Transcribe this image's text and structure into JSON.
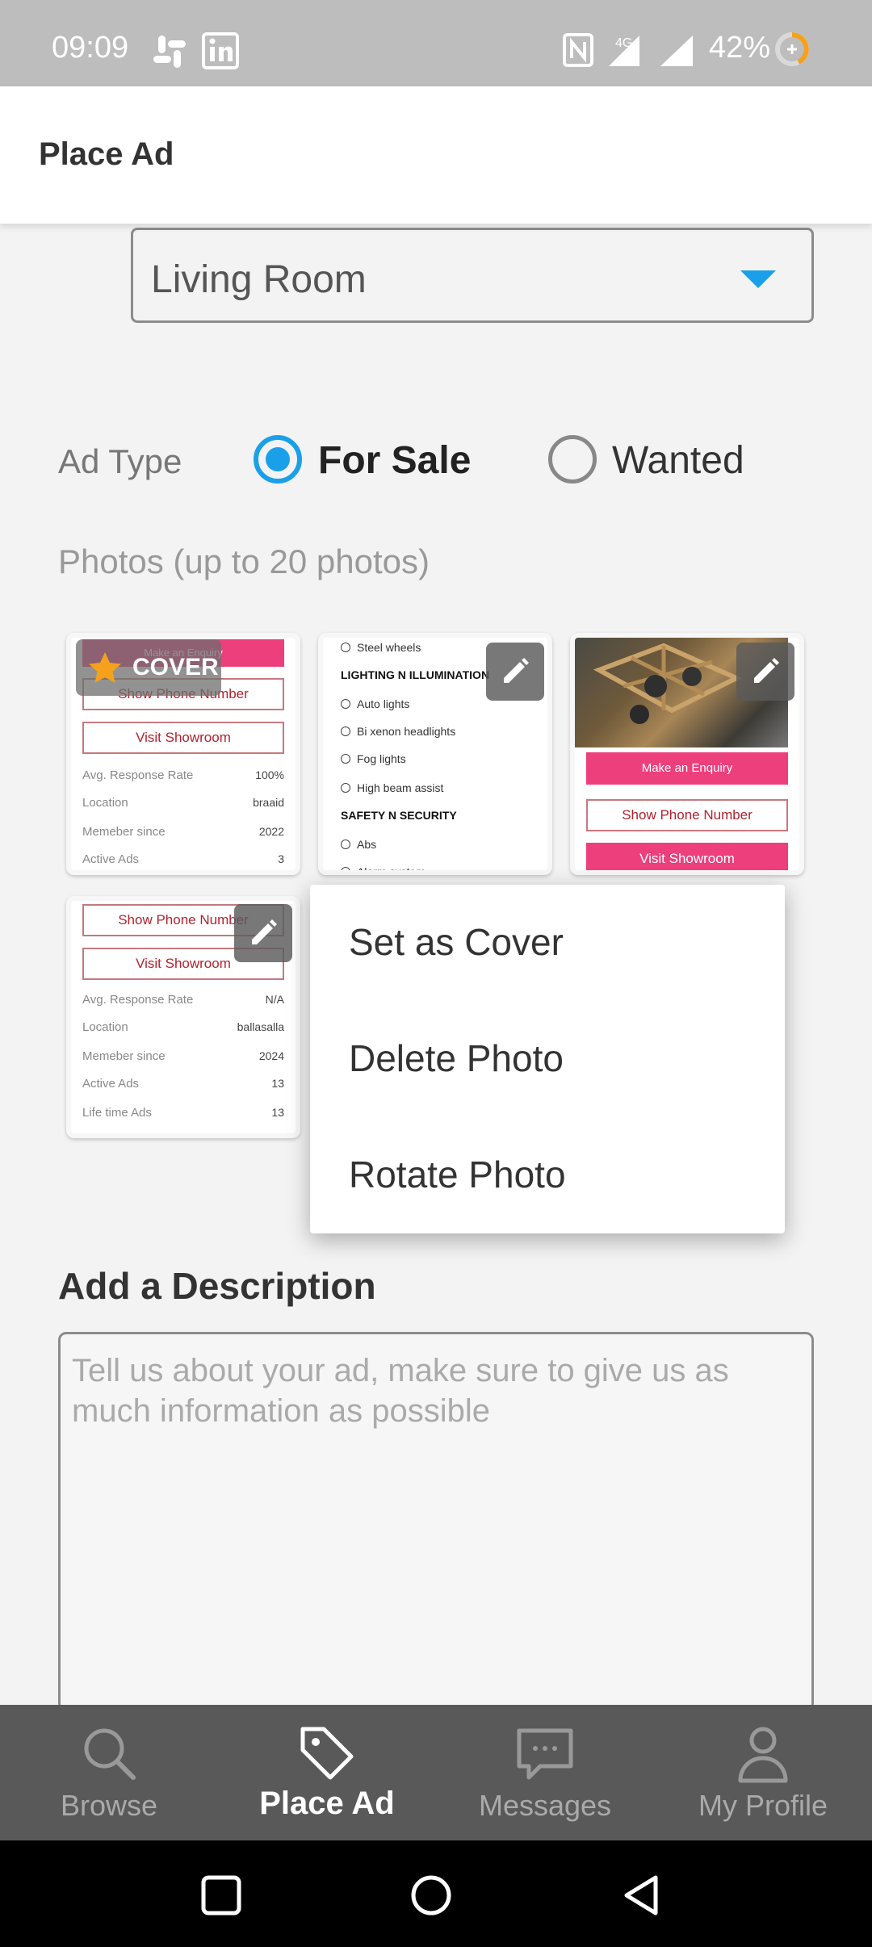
{
  "status_bar": {
    "time": "09:09",
    "network": "4G+",
    "battery": "42%"
  },
  "appbar": {
    "title": "Place Ad"
  },
  "category": {
    "value": "Living Room"
  },
  "ad_type": {
    "label": "Ad Type",
    "options": [
      {
        "label": "For Sale",
        "selected": true
      },
      {
        "label": "Wanted",
        "selected": false
      }
    ]
  },
  "photos": {
    "label": "Photos (up to 20 photos)",
    "cover_badge": "COVER",
    "thumb1": {
      "top_btn": "Make an Enquiry",
      "phone_btn": "Show Phone Number",
      "showroom_btn": "Visit Showroom",
      "rows": [
        {
          "k": "Avg. Response Rate",
          "v": "100%"
        },
        {
          "k": "Location",
          "v": "braaid"
        },
        {
          "k": "Memeber since",
          "v": "2022"
        },
        {
          "k": "Active Ads",
          "v": "3"
        }
      ]
    },
    "thumb2": {
      "items": [
        {
          "type": "item",
          "text": "Steel wheels"
        },
        {
          "type": "heading",
          "text": "LIGHTING N ILLUMINATION"
        },
        {
          "type": "item",
          "text": "Auto lights"
        },
        {
          "type": "item",
          "text": "Bi xenon headlights"
        },
        {
          "type": "item",
          "text": "Fog lights"
        },
        {
          "type": "item",
          "text": "High beam assist"
        },
        {
          "type": "heading",
          "text": "SAFETY N SECURITY"
        },
        {
          "type": "item",
          "text": "Abs"
        },
        {
          "type": "item",
          "text": "Alarm system"
        }
      ]
    },
    "thumb3": {
      "enquiry_btn": "Make an Enquiry",
      "phone_btn": "Show Phone Number",
      "showroom_btn": "Visit Showroom"
    },
    "thumb4": {
      "phone_btn": "Show Phone Number",
      "showroom_btn": "Visit Showroom",
      "rows": [
        {
          "k": "Avg. Response Rate",
          "v": "N/A"
        },
        {
          "k": "Location",
          "v": "ballasalla"
        },
        {
          "k": "Memeber since",
          "v": "2024"
        },
        {
          "k": "Active Ads",
          "v": "13"
        },
        {
          "k": "Life time Ads",
          "v": "13"
        }
      ]
    }
  },
  "photo_menu": {
    "items": [
      "Set as Cover",
      "Delete Photo",
      "Rotate Photo"
    ]
  },
  "description": {
    "title": "Add a Description",
    "placeholder": "Tell us about your ad, make sure to give us as much information as possible"
  },
  "bottom_nav": {
    "items": [
      {
        "label": "Browse",
        "icon": "search-icon",
        "active": false
      },
      {
        "label": "Place Ad",
        "icon": "tag-icon",
        "active": true
      },
      {
        "label": "Messages",
        "icon": "chat-icon",
        "active": false
      },
      {
        "label": "My Profile",
        "icon": "person-icon",
        "active": false
      }
    ]
  },
  "colors": {
    "accent": "#1aa0e8",
    "pink": "#ec3f7b",
    "cover_star": "#f5a11c",
    "nav_bg": "#595959"
  }
}
